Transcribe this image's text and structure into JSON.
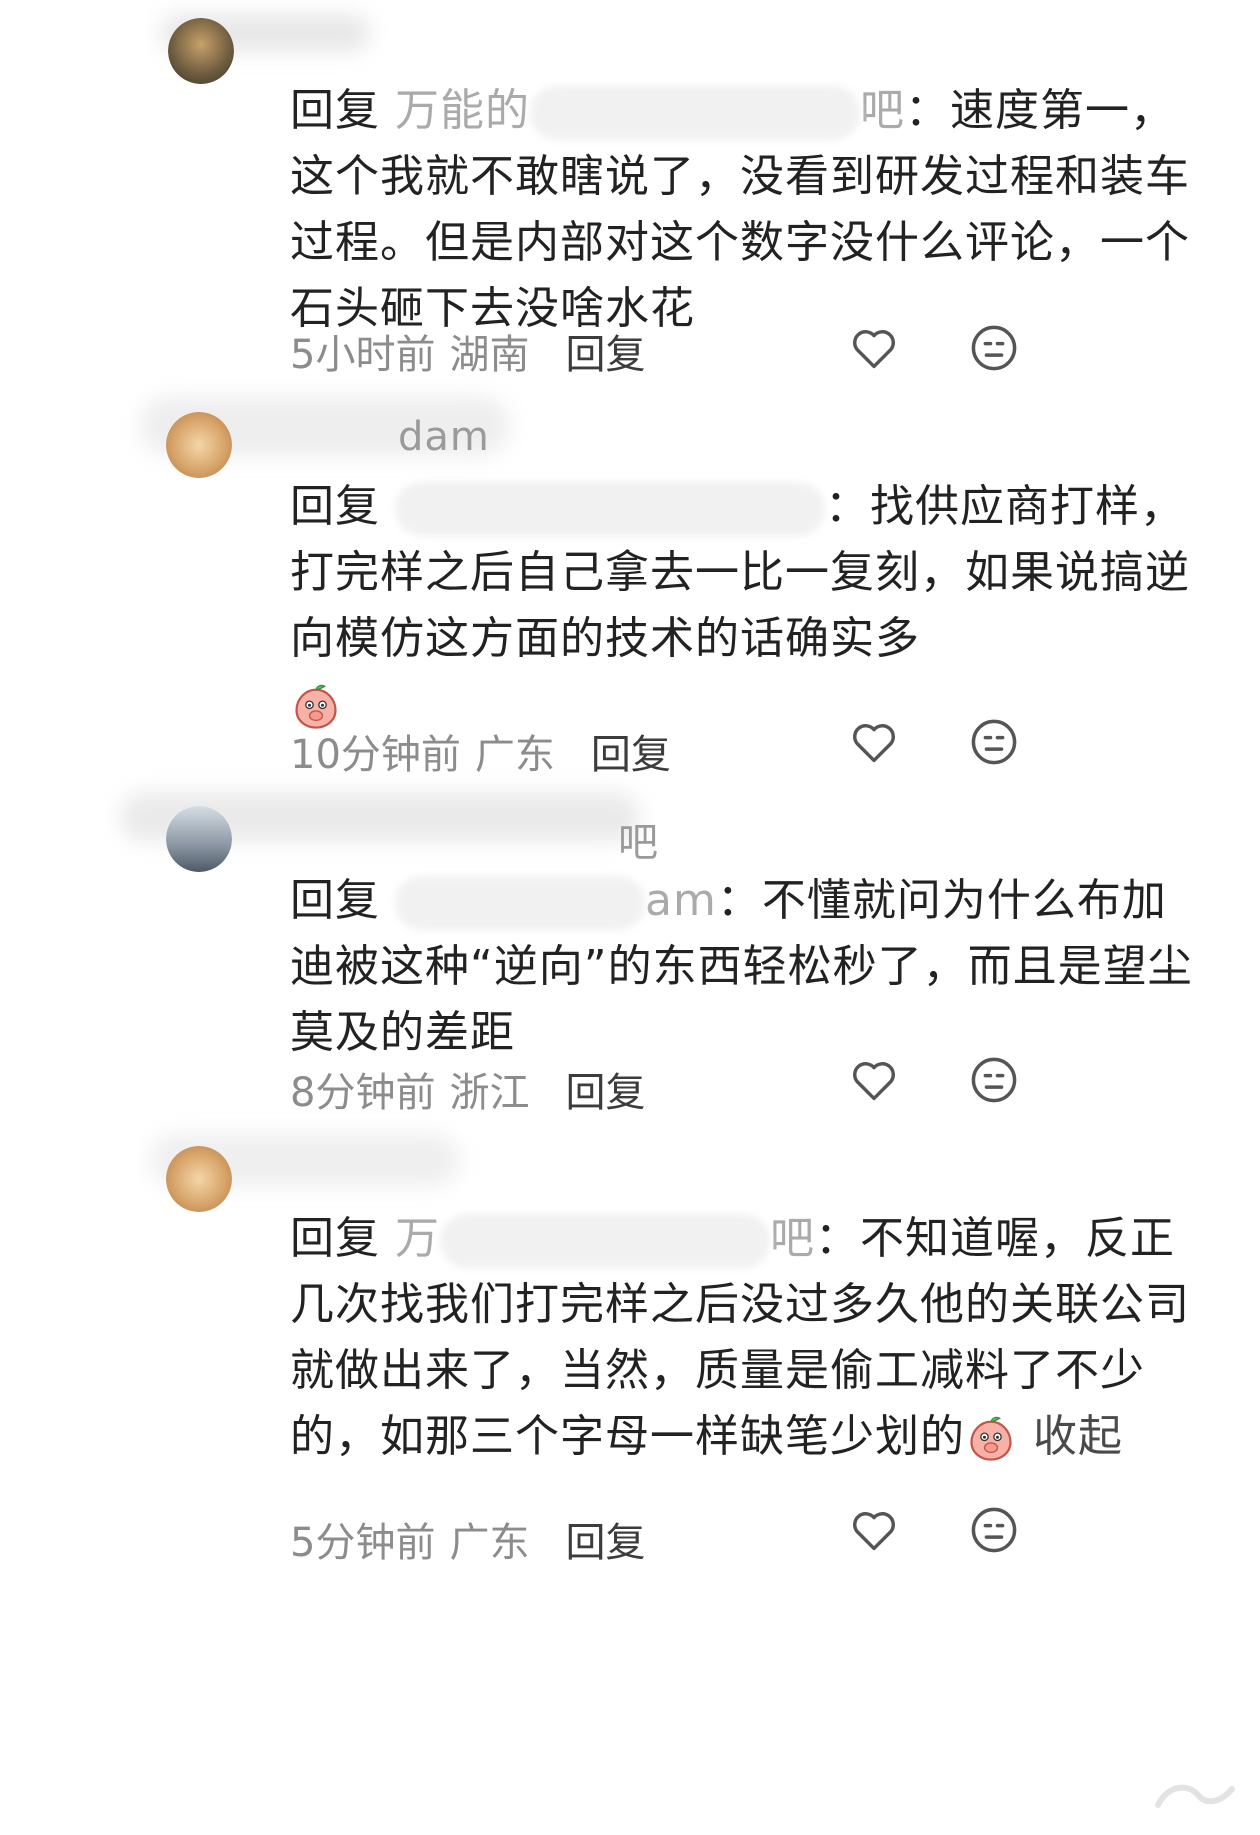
{
  "comments": [
    {
      "name_visible": "",
      "reply_label": "回复",
      "target_visible_start": "万能的",
      "target_visible_end": "吧",
      "colon": "：",
      "text": "速度第一，这个我就不敢瞎说了，没看到研发过程和装车过程。但是内部对这个数字没什么评论，一个石头砸下去没啥水花",
      "time": "5小时前",
      "location": "湖南",
      "reply_button": "回复"
    },
    {
      "name_visible": "dam",
      "reply_label": "回复",
      "target_visible_start": "",
      "target_visible_end": "",
      "colon": "：",
      "text": "找供应商打样，打完样之后自己拿去一比一复刻，如果说搞逆向模仿这方面的技术的话确实多",
      "emoji": "peach-cover-mouth-emoji",
      "time": "10分钟前",
      "location": "广东",
      "reply_button": "回复"
    },
    {
      "name_visible": "吧",
      "reply_label": "回复",
      "target_visible_start": "",
      "target_visible_end": "am",
      "colon": "：",
      "text": "不懂就问为什么布加迪被这种“逆向”的东西轻松秒了，而且是望尘莫及的差距",
      "time": "8分钟前",
      "location": "浙江",
      "reply_button": "回复"
    },
    {
      "name_visible": "",
      "reply_label": "回复",
      "target_visible_start": "万",
      "target_visible_end": "吧",
      "colon": "：",
      "text": "不知道喔，反正几次找我们打完样之后没过多久他的关联公司就做出来了，当然，质量是偷工减料了不少的，如那三个字母一样缺笔少划的",
      "emoji": "peach-cover-mouth-emoji",
      "collapse_label": "收起",
      "time": "5分钟前",
      "location": "广东",
      "reply_button": "回复"
    }
  ],
  "icons": {
    "like": "heart-outline-icon",
    "dislike": "meh-face-icon"
  },
  "colors": {
    "text": "#222222",
    "meta": "#8c8c8c",
    "icon": "#555555",
    "background": "#ffffff"
  }
}
